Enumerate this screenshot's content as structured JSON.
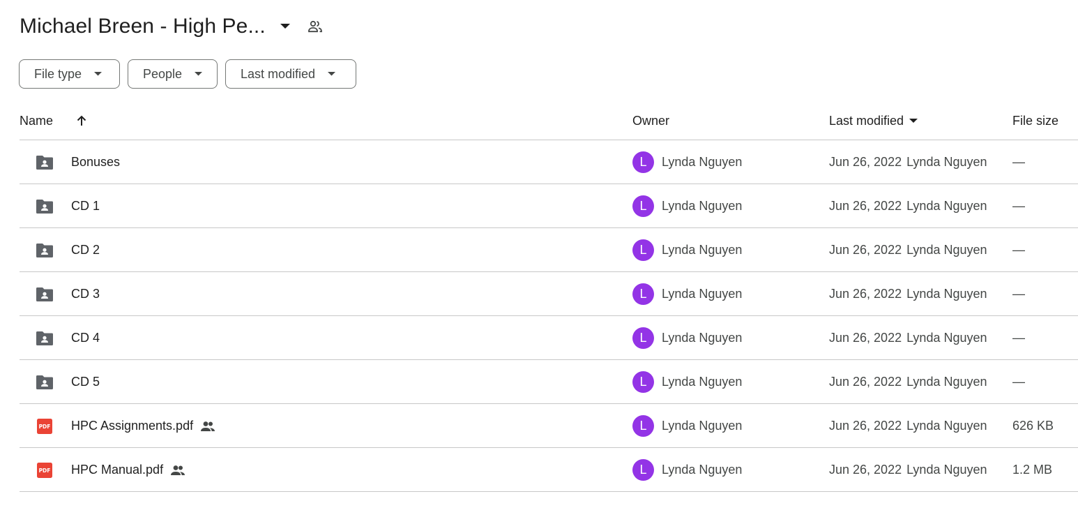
{
  "header": {
    "folder_title": "Michael Breen - High Pe...",
    "caret_icon": "arrow-drop-down-icon",
    "shared_icon": "shared-people-icon"
  },
  "filters": [
    {
      "label": "File type"
    },
    {
      "label": "People"
    },
    {
      "label": "Last modified"
    }
  ],
  "table": {
    "columns": {
      "name": "Name",
      "owner": "Owner",
      "last_modified": "Last modified",
      "file_size": "File size"
    },
    "rows": [
      {
        "type": "shared-folder",
        "name": "Bonuses",
        "shared": false,
        "owner": "Lynda Nguyen",
        "owner_initial": "L",
        "modified_date": "Jun 26, 2022",
        "modified_by": "Lynda Nguyen",
        "size": "—"
      },
      {
        "type": "shared-folder",
        "name": "CD 1",
        "shared": false,
        "owner": "Lynda Nguyen",
        "owner_initial": "L",
        "modified_date": "Jun 26, 2022",
        "modified_by": "Lynda Nguyen",
        "size": "—"
      },
      {
        "type": "shared-folder",
        "name": "CD 2",
        "shared": false,
        "owner": "Lynda Nguyen",
        "owner_initial": "L",
        "modified_date": "Jun 26, 2022",
        "modified_by": "Lynda Nguyen",
        "size": "—"
      },
      {
        "type": "shared-folder",
        "name": "CD 3",
        "shared": false,
        "owner": "Lynda Nguyen",
        "owner_initial": "L",
        "modified_date": "Jun 26, 2022",
        "modified_by": "Lynda Nguyen",
        "size": "—"
      },
      {
        "type": "shared-folder",
        "name": "CD 4",
        "shared": false,
        "owner": "Lynda Nguyen",
        "owner_initial": "L",
        "modified_date": "Jun 26, 2022",
        "modified_by": "Lynda Nguyen",
        "size": "—"
      },
      {
        "type": "shared-folder",
        "name": "CD 5",
        "shared": false,
        "owner": "Lynda Nguyen",
        "owner_initial": "L",
        "modified_date": "Jun 26, 2022",
        "modified_by": "Lynda Nguyen",
        "size": "—"
      },
      {
        "type": "pdf",
        "name": "HPC Assignments.pdf",
        "shared": true,
        "owner": "Lynda Nguyen",
        "owner_initial": "L",
        "modified_date": "Jun 26, 2022",
        "modified_by": "Lynda Nguyen",
        "size": "626 KB"
      },
      {
        "type": "pdf",
        "name": "HPC Manual.pdf",
        "shared": true,
        "owner": "Lynda Nguyen",
        "owner_initial": "L",
        "modified_date": "Jun 26, 2022",
        "modified_by": "Lynda Nguyen",
        "size": "1.2 MB"
      }
    ]
  },
  "colors": {
    "avatar": "#9334e6",
    "pdf_icon": "#ea4335",
    "folder_icon": "#5f6368",
    "divider": "#c7c7c7"
  },
  "pdf_icon_text": "PDF"
}
